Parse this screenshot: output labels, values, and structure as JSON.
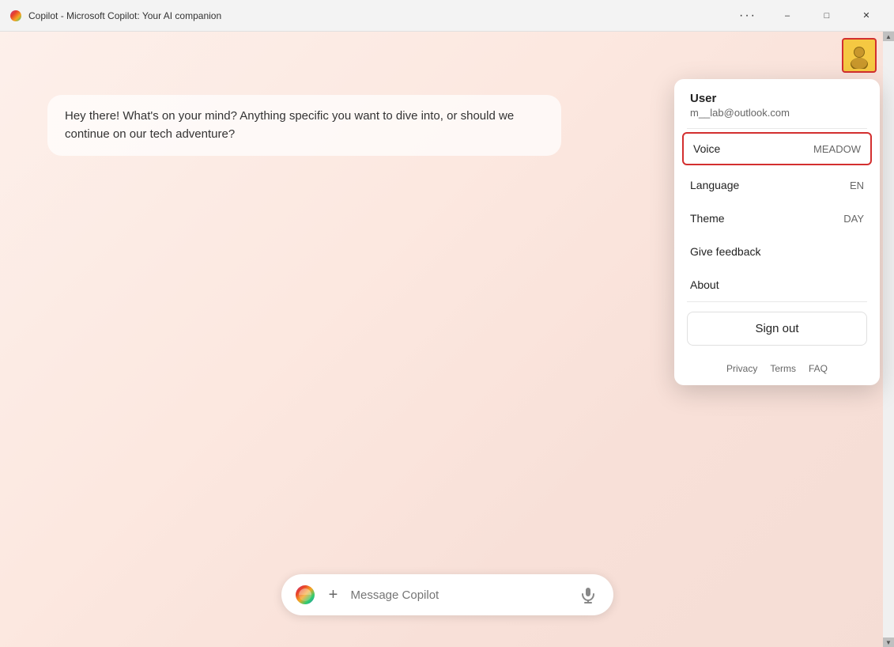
{
  "titleBar": {
    "title": "Copilot - Microsoft Copilot: Your AI companion",
    "dotsLabel": "···",
    "minimizeLabel": "–",
    "maximizeLabel": "□",
    "closeLabel": "✕"
  },
  "chat": {
    "message": "Hey there! What's on your mind? Anything specific you want to dive into, or should we continue on our tech adventure?"
  },
  "inputBar": {
    "placeholder": "Message Copilot",
    "addLabel": "+",
    "micLabel": "🎤"
  },
  "userMenu": {
    "username": "User",
    "email": "m__lab@outlook.com",
    "items": [
      {
        "id": "voice",
        "label": "Voice",
        "value": "MEADOW",
        "highlighted": true
      },
      {
        "id": "language",
        "label": "Language",
        "value": "EN",
        "highlighted": false
      },
      {
        "id": "theme",
        "label": "Theme",
        "value": "DAY",
        "highlighted": false
      },
      {
        "id": "feedback",
        "label": "Give feedback",
        "value": "",
        "highlighted": false
      },
      {
        "id": "about",
        "label": "About",
        "value": "",
        "highlighted": false
      }
    ],
    "signOut": "Sign out",
    "footer": {
      "privacy": "Privacy",
      "terms": "Terms",
      "faq": "FAQ"
    }
  },
  "scrollbar": {
    "upArrow": "▲",
    "downArrow": "▼"
  }
}
